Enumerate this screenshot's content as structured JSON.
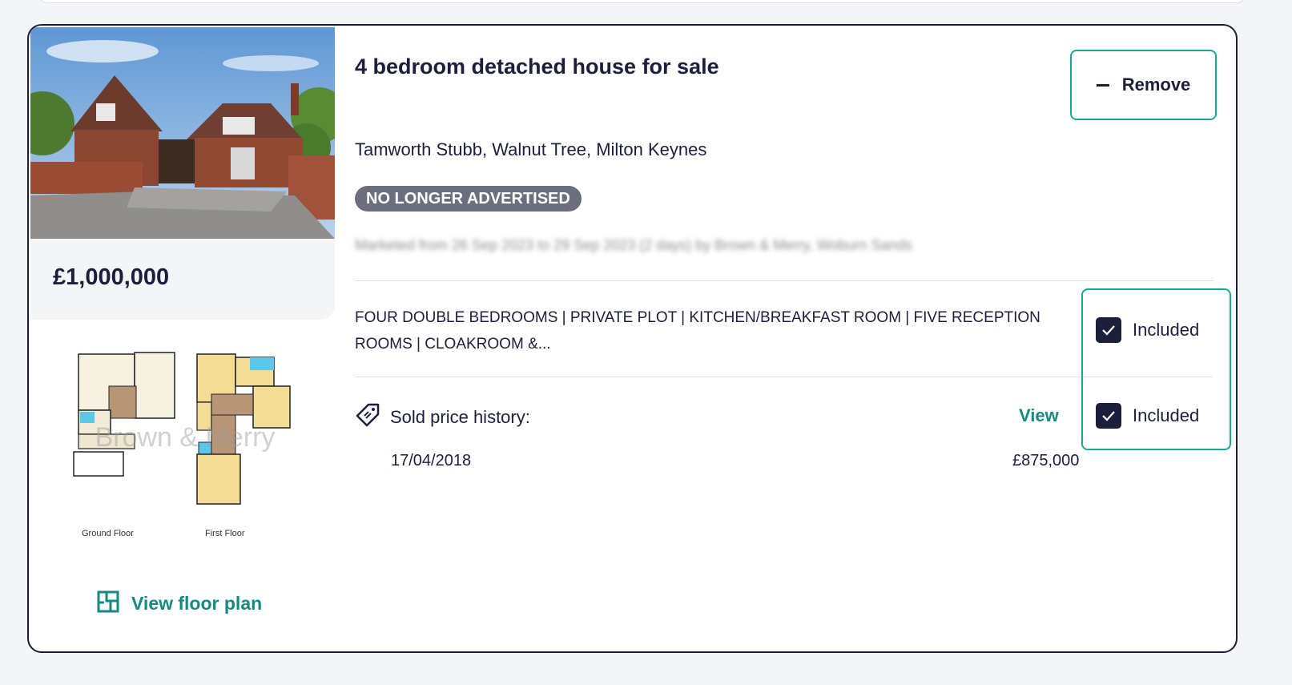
{
  "listing": {
    "title": "4 bedroom detached house for sale",
    "address": "Tamworth Stubb, Walnut Tree, Milton Keynes",
    "status_badge": "NO LONGER ADVERTISED",
    "marketed_text": "Marketed from 26 Sep 2023 to 29 Sep 2023 (2 days) by Brown & Merry, Woburn Sands",
    "price": "£1,000,000",
    "features_text": "FOUR DOUBLE BEDROOMS | PRIVATE PLOT | KITCHEN/BREAKFAST ROOM | FIVE RECEPTION ROOMS | CLOAKROOM &...",
    "remove_label": "Remove",
    "features_included_label": "Included",
    "sold_history_included_label": "Included",
    "sold_price_history_label": "Sold price history:",
    "view_label": "View",
    "sold_history": [
      {
        "date": "17/04/2018",
        "price": "£875,000"
      }
    ]
  },
  "floorplan": {
    "watermark": "Brown & Merry",
    "ground_floor_caption": "Ground Floor",
    "first_floor_caption": "First Floor",
    "view_label": "View floor plan"
  },
  "colors": {
    "accent": "#158a80",
    "outline_teal": "#1aa896",
    "navy": "#1b1f3b",
    "badge_gray": "#6b6e7d"
  },
  "icons": {
    "remove": "minus-icon",
    "checkbox": "check-icon",
    "sold_history": "price-tag-icon",
    "floorplan": "floorplan-icon"
  }
}
